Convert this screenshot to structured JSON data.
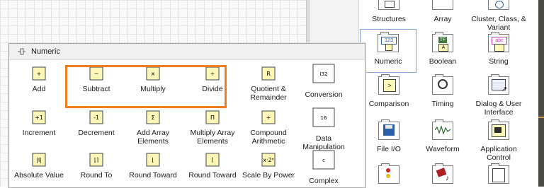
{
  "palette": {
    "sidebar_items": [],
    "items": [
      {
        "id": "structures",
        "label": "Structures",
        "icon": "structures-icon"
      },
      {
        "id": "array",
        "label": "Array",
        "icon": "array-icon"
      },
      {
        "id": "cluster",
        "label": "Cluster, Class, & Variant",
        "icon": "cluster-icon"
      },
      {
        "id": "numeric",
        "label": "Numeric",
        "icon": "numeric-folder-icon",
        "selected": true
      },
      {
        "id": "boolean",
        "label": "Boolean",
        "icon": "boolean-icon"
      },
      {
        "id": "string",
        "label": "String",
        "icon": "string-icon"
      },
      {
        "id": "comparison",
        "label": "Comparison",
        "icon": "comparison-icon"
      },
      {
        "id": "timing",
        "label": "Timing",
        "icon": "timing-icon"
      },
      {
        "id": "dialog",
        "label": "Dialog & User Interface",
        "icon": "dialog-icon"
      },
      {
        "id": "fileio",
        "label": "File I/O",
        "icon": "file-io-icon"
      },
      {
        "id": "waveform",
        "label": "Waveform",
        "icon": "waveform-icon"
      },
      {
        "id": "appcontrol",
        "label": "Application Control",
        "icon": "application-control-icon"
      }
    ]
  },
  "numeric_window": {
    "title": "Numeric",
    "items": [
      {
        "label": "Add",
        "glyph": "+"
      },
      {
        "label": "Subtract",
        "glyph": "−"
      },
      {
        "label": "Multiply",
        "glyph": "×"
      },
      {
        "label": "Divide",
        "glyph": "÷"
      },
      {
        "label": "Quotient & Remainder",
        "glyph": "R"
      },
      {
        "label": "Conversion",
        "glyph": "I32"
      },
      {
        "label": "Increment",
        "glyph": "+1"
      },
      {
        "label": "Decrement",
        "glyph": "-1"
      },
      {
        "label": "Add Array Elements",
        "glyph": "Σ"
      },
      {
        "label": "Multiply Array Elements",
        "glyph": "Π"
      },
      {
        "label": "Compound Arithmetic",
        "glyph": "+"
      },
      {
        "label": "Data Manipulation",
        "glyph": "16"
      },
      {
        "label": "Absolute Value",
        "glyph": "|I|"
      },
      {
        "label": "Round To",
        "glyph": "⌊⌉"
      },
      {
        "label": "Round Toward",
        "glyph": "⌊"
      },
      {
        "label": "Round Toward",
        "glyph": "⌈"
      },
      {
        "label": "Scale By Power",
        "glyph": "x·2ⁿ"
      },
      {
        "label": "Complex",
        "glyph": "c"
      }
    ]
  },
  "colors": {
    "highlight": "#f07d1e",
    "selection": "#7aa7d6",
    "icon_yellow": "#fdf7b8"
  }
}
